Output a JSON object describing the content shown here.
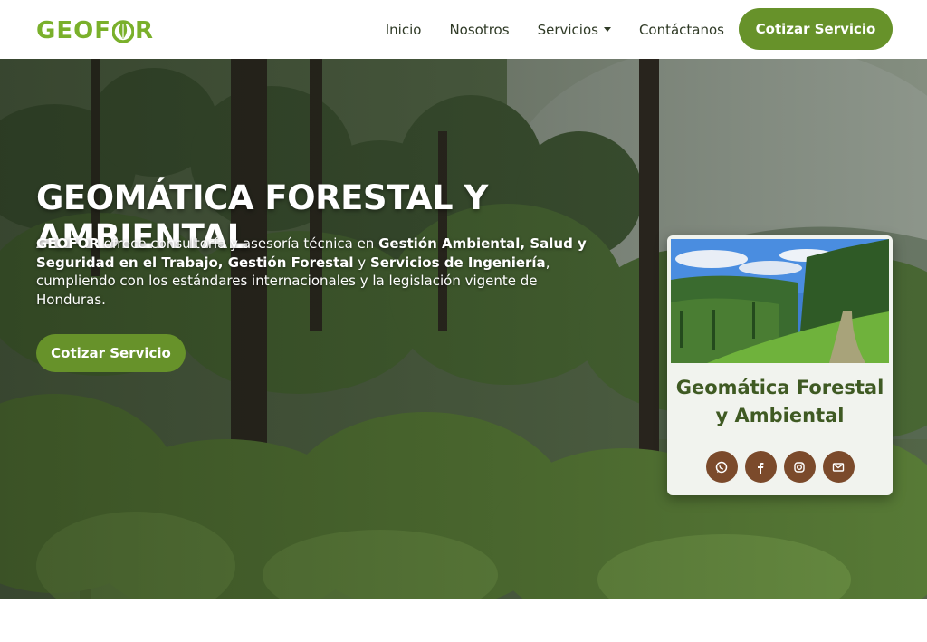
{
  "brand": {
    "logo_text_left": "GEOF",
    "logo_text_right": "R",
    "accent": "#7ab02b",
    "cta_color": "#67922a",
    "social_color": "#7b4a2b"
  },
  "nav": {
    "items": [
      {
        "label": "Inicio"
      },
      {
        "label": "Nosotros"
      },
      {
        "label": "Servicios"
      },
      {
        "label": "Contáctanos"
      }
    ],
    "cta_label": "Cotizar Servicio"
  },
  "hero": {
    "title": "GEOMÁTICA FORESTAL Y AMBIENTAL",
    "desc": {
      "p1_bold": "GEOFOR",
      "p2": " ofrece consultoría y asesoría técnica en ",
      "p3_bold": "Gestión Ambiental, Salud y Seguridad en el Trabajo, Gestión Forestal",
      "p4": " y ",
      "p5_bold": "Servicios de Ingeniería",
      "p6": ", cumpliendo con los estándares internacionales y la legislación vigente de Honduras."
    },
    "cta_label": "Cotizar Servicio"
  },
  "card": {
    "title_line1": "Geomática Forestal",
    "title_line2": "y Ambiental",
    "socials": [
      {
        "icon": "whatsapp-icon"
      },
      {
        "icon": "facebook-icon"
      },
      {
        "icon": "instagram-icon"
      },
      {
        "icon": "email-icon"
      }
    ]
  }
}
